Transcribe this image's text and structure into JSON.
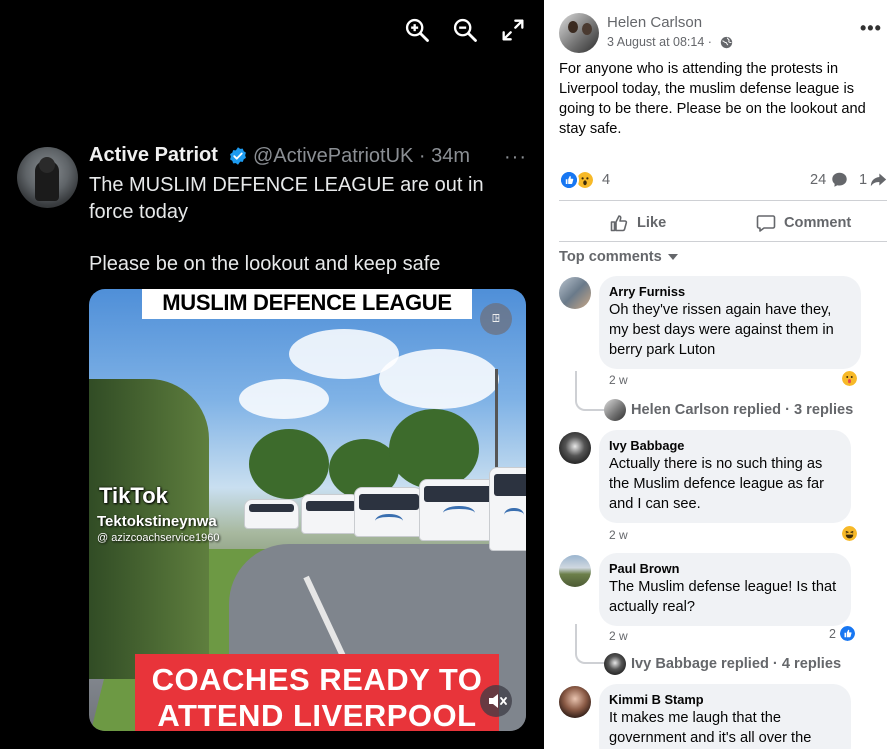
{
  "viewer": {
    "controls": {
      "zoom_in": "zoom-in",
      "zoom_out": "zoom-out",
      "fullscreen": "expand"
    },
    "tweet": {
      "name": "Active Patriot",
      "handle": "@ActivePatriotUK · 34m",
      "more": "···",
      "text_line1": "The MUSLIM DEFENCE LEAGUE are out in force today",
      "text_line2": "Please be on the lookout and keep safe",
      "media": {
        "header": "MUSLIM DEFENCE LEAGUE",
        "tiktok_logo": "TikTok",
        "tiktok_overlay": "Tektokstineynwa",
        "tiktok_handle": "@ azizcoachservice1960",
        "caption": "COACHES READY TO ATTEND LIVERPOOL",
        "badge": "ꖸ"
      }
    }
  },
  "post": {
    "author": "Helen Carlson",
    "date": "3 August at 08:14 ·",
    "more": "•••",
    "text": "For anyone who is attending the protests in Liverpool today, the muslim defense league is going to be there. Please be on the lookout and stay safe.",
    "reactions_count": "4",
    "comments_count": "24",
    "shares_count": "1",
    "like_label": "Like",
    "comment_label": "Comment",
    "top_comments_label": "Top comments",
    "colors": {
      "like_blue": "#1877f2",
      "haha_yellow": "#f7b928",
      "muted_text": "#65676b",
      "bubble": "#f0f2f5"
    }
  },
  "comments": [
    {
      "name": "Arry Furniss",
      "text": "Oh they've rissen again have they, my best days were against them in berry park Luton",
      "time": "2 w",
      "reaction": "wow",
      "replies_label": "Helen Carlson replied · 3 replies"
    },
    {
      "name": "Ivy Babbage",
      "text": "Actually there is no such thing as the Muslim defence league as far and I can see.",
      "time": "2 w",
      "reaction": "haha"
    },
    {
      "name": "Paul Brown",
      "text": "The Muslim defense league! Is that actually real?",
      "time": "2 w",
      "reaction_count": "2",
      "reaction": "like",
      "replies_label": "Ivy Babbage replied · 4 replies"
    },
    {
      "name": "Kimmi B Stamp",
      "text": "It makes me laugh that the government and it's all over the"
    }
  ]
}
